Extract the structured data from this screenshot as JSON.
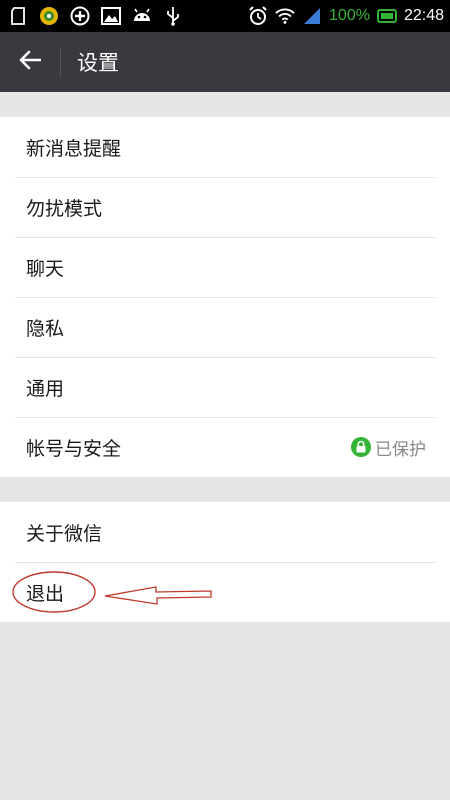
{
  "status_bar": {
    "battery_percent": "100%",
    "time": "22:48",
    "icons": [
      "sd-card-icon",
      "app-badge-icon",
      "add-circle-icon",
      "image-icon",
      "android-icon",
      "usb-icon",
      "alarm-icon",
      "wifi-icon",
      "signal-icon",
      "battery-icon"
    ]
  },
  "header": {
    "back_icon": "arrow-left-icon",
    "title": "设置"
  },
  "settings": {
    "group1": [
      {
        "label": "新消息提醒"
      },
      {
        "label": "勿扰模式"
      },
      {
        "label": "聊天"
      },
      {
        "label": "隐私"
      },
      {
        "label": "通用"
      },
      {
        "label": "帐号与安全",
        "status": "已保护",
        "status_icon": "lock-icon"
      }
    ],
    "group2": [
      {
        "label": "关于微信"
      },
      {
        "label": "退出"
      }
    ]
  },
  "colors": {
    "title_bar": "#393a3f",
    "status_bar": "#000000",
    "background": "#e6e6e6",
    "accent_green": "#35b335",
    "annotation_red": "#c0392b"
  }
}
